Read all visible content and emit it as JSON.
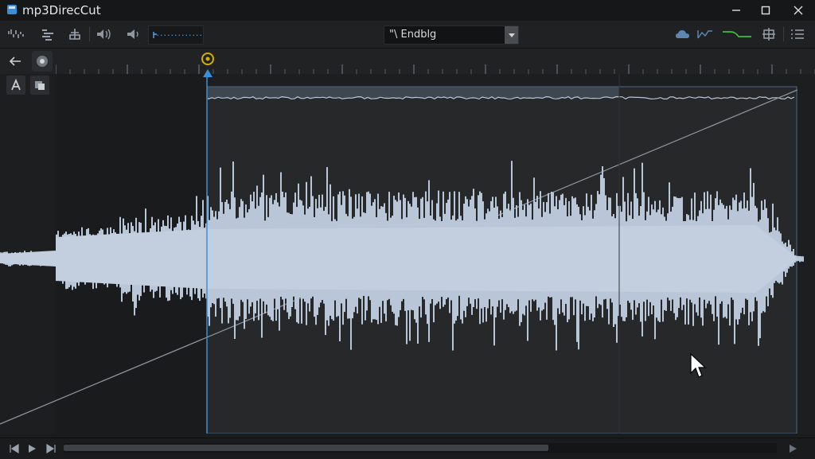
{
  "app": {
    "title": "mp3DirecCut"
  },
  "window": {
    "minimize_icon": "minimize-icon",
    "maximize_icon": "maximize-icon",
    "close_icon": "close-icon"
  },
  "toolbar": {
    "level_display": "·············",
    "preset_value": "\"\\ Endblg"
  },
  "colors": {
    "background": "#1b1c1e",
    "selection": "#262829",
    "waveform": "#b9c6d8",
    "selection_border": "#5a86b8",
    "accent_blue": "#3a8fd8",
    "marker_yellow": "#d1b000",
    "fade_green": "#3bbf3b"
  },
  "scroll": {
    "position_fraction": 0.68
  }
}
